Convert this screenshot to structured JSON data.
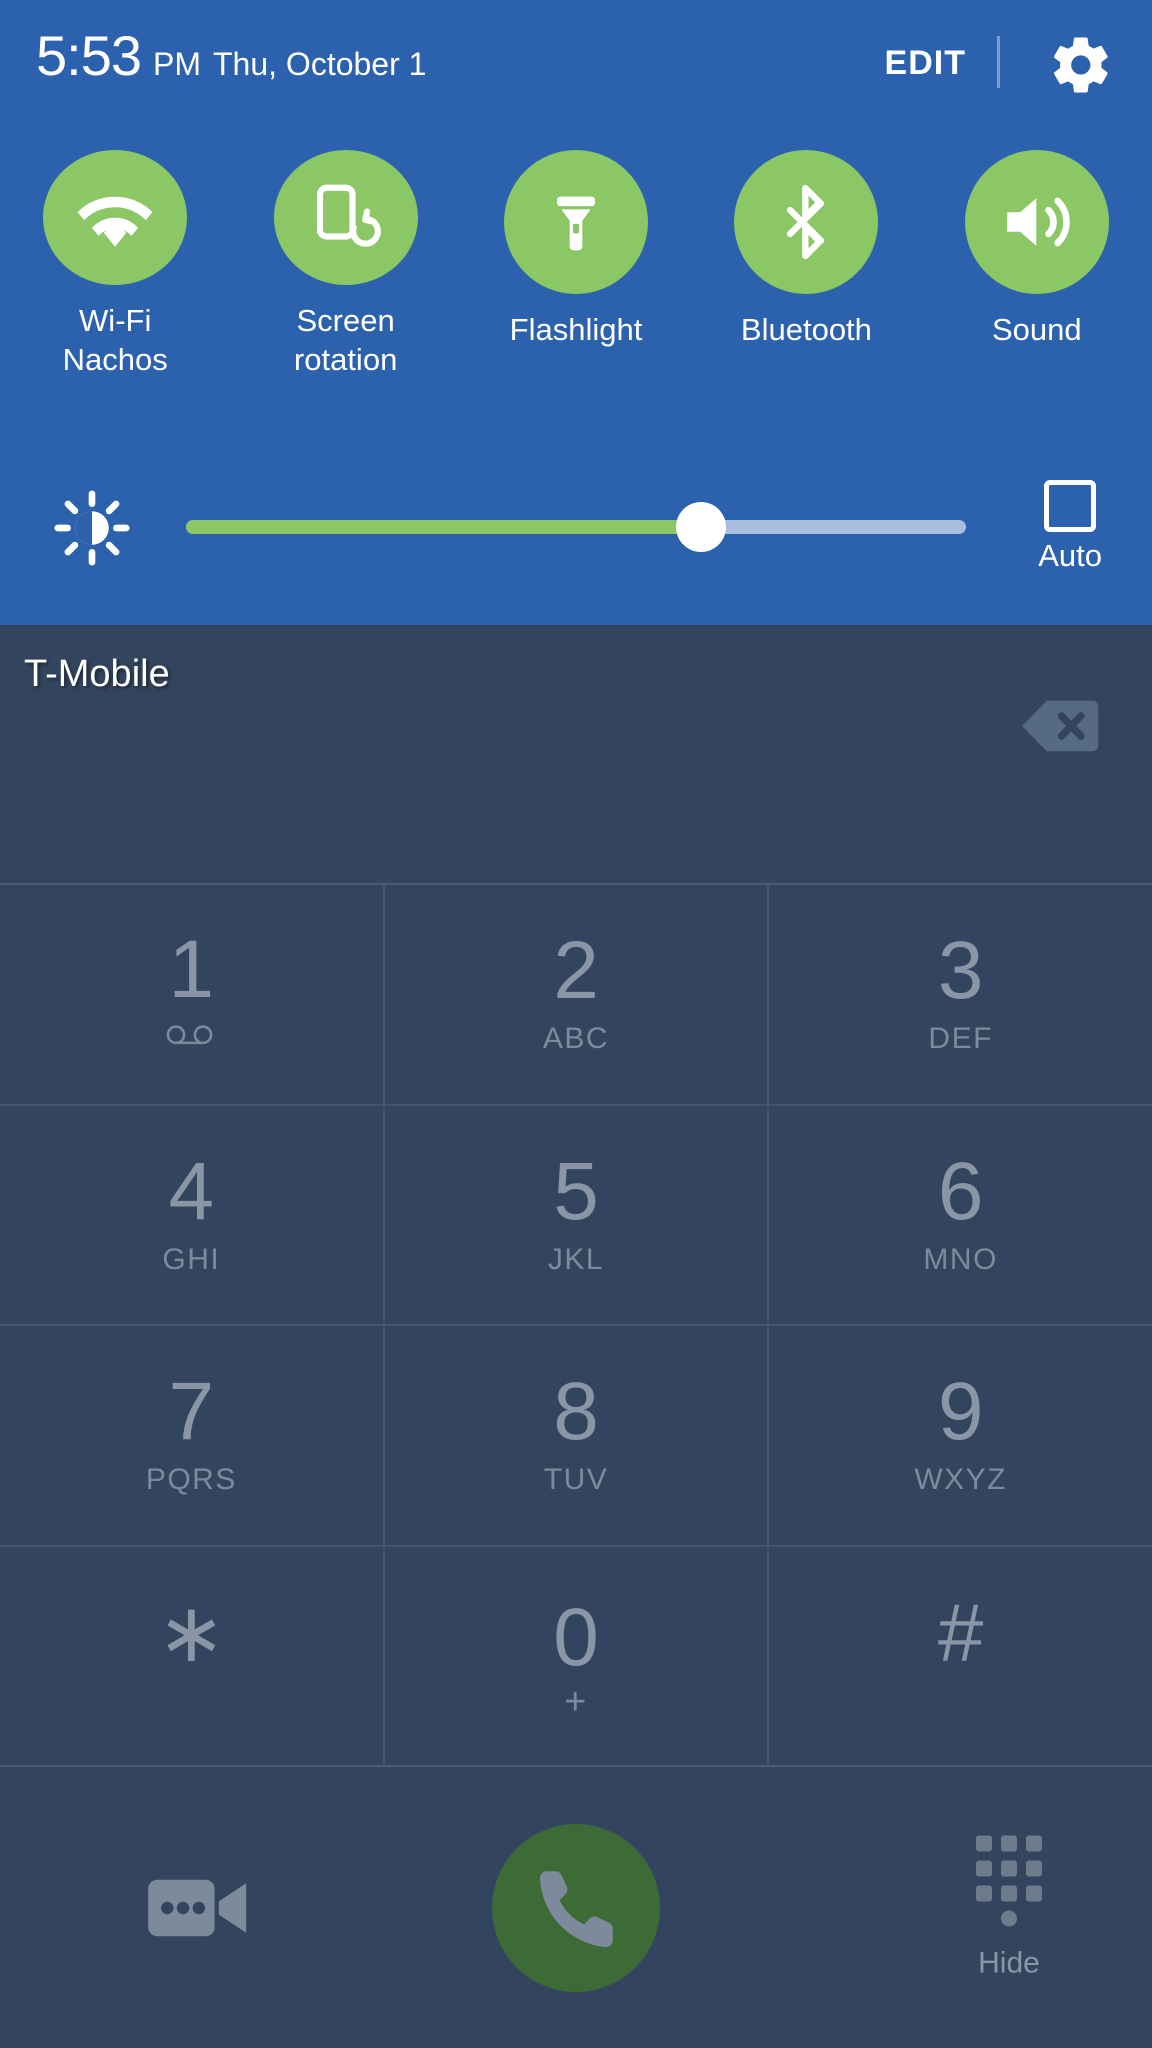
{
  "quick_settings": {
    "clock": {
      "time": "5:53",
      "ampm": "PM",
      "date": "Thu, October 1"
    },
    "edit_label": "EDIT",
    "settings_icon": "gear-icon",
    "toggles": [
      {
        "icon": "wifi-icon",
        "label": "Wi-Fi",
        "sub": "Nachos",
        "state": "on"
      },
      {
        "icon": "screen-rotation-icon",
        "label": "Screen",
        "sub": "rotation",
        "state": "on"
      },
      {
        "icon": "flashlight-icon",
        "label": "Flashlight",
        "sub": "",
        "state": "on"
      },
      {
        "icon": "bluetooth-icon",
        "label": "Bluetooth",
        "sub": "",
        "state": "on"
      },
      {
        "icon": "sound-volume-icon",
        "label": "Sound",
        "sub": "",
        "state": "on"
      }
    ],
    "brightness": {
      "icon": "brightness-sun-icon",
      "value_percent": 66,
      "auto_label": "Auto",
      "auto_checked": false
    },
    "colors": {
      "panel": "#2C62AD",
      "accent_green": "#8BC765",
      "track": "#A9BEDC"
    }
  },
  "dialer": {
    "carrier": "T-Mobile",
    "number_entry": "",
    "backspace_icon": "backspace-icon",
    "keys": [
      [
        {
          "digit": "1",
          "sub": "",
          "icon": "voicemail-icon"
        },
        {
          "digit": "2",
          "sub": "ABC",
          "icon": ""
        },
        {
          "digit": "3",
          "sub": "DEF",
          "icon": ""
        }
      ],
      [
        {
          "digit": "4",
          "sub": "GHI",
          "icon": ""
        },
        {
          "digit": "5",
          "sub": "JKL",
          "icon": ""
        },
        {
          "digit": "6",
          "sub": "MNO",
          "icon": ""
        }
      ],
      [
        {
          "digit": "7",
          "sub": "PQRS",
          "icon": ""
        },
        {
          "digit": "8",
          "sub": "TUV",
          "icon": ""
        },
        {
          "digit": "9",
          "sub": "WXYZ",
          "icon": ""
        }
      ],
      [
        {
          "digit": "∗",
          "sub": "",
          "icon": ""
        },
        {
          "digit": "0",
          "sub": "+",
          "icon": ""
        },
        {
          "digit": "#",
          "sub": "",
          "icon": ""
        }
      ]
    ],
    "actions": {
      "video_call_icon": "video-call-icon",
      "call_icon": "phone-call-icon",
      "hide_icon": "keypad-dots-icon",
      "hide_label": "Hide"
    },
    "colors": {
      "background": "#33455E",
      "call_button": "#3D6B35",
      "key_text": "#8A96A6"
    }
  }
}
